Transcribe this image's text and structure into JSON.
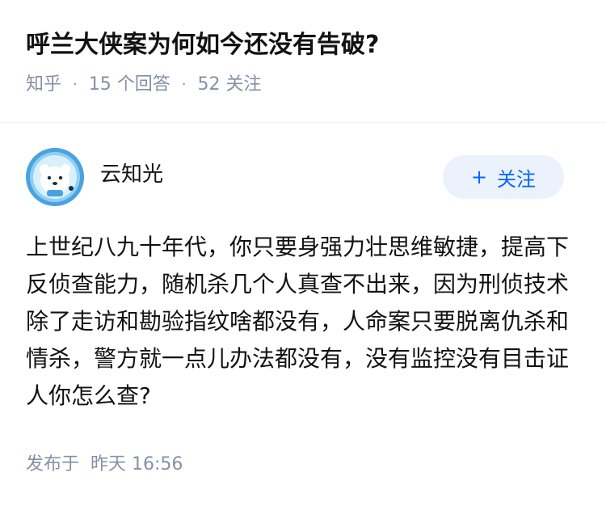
{
  "question": {
    "title": "呼兰大侠案为何如今还没有告破?",
    "source": "知乎",
    "answers_count": "15 个回答",
    "followers_count": "52 关注",
    "separator": "·"
  },
  "author": {
    "name": "云知光",
    "follow_label": "关注",
    "follow_icon": "plus-icon"
  },
  "answer": {
    "content": "上世纪八九十年代，你只要身强力壮思维敏捷，提高下反侦查能力，随机杀几个人真查不出来，因为刑侦技术除了走访和勘验指纹啥都没有，人命案只要脱离仇杀和情杀，警方就一点儿办法都没有，没有监控没有目击证人你怎么查?",
    "posted_label": "发布于",
    "posted_time": "昨天 16:56"
  },
  "colors": {
    "accent": "#0066ff",
    "follow_bg": "#ebf2fb",
    "meta_gray": "#8590a6",
    "avatar_bg": "#4aa3df"
  }
}
